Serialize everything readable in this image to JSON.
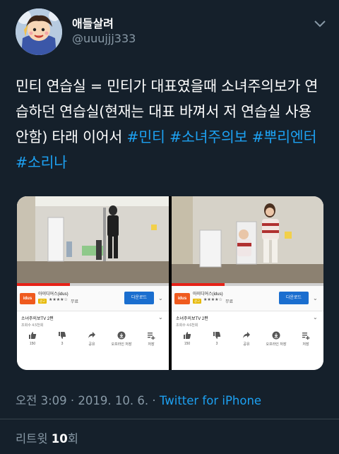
{
  "user": {
    "display_name": "애들살려",
    "handle": "@uuujjj333",
    "avatar": "cartoon-avatar"
  },
  "tweet": {
    "text_plain": "민티 연습실 = 민티가 대표였을때 소녀주의보가 연습하던 연습실(현재는 대표 바껴서 저 연습실 사용 안함) 타래 이어서 ",
    "hashtags": [
      "#민티",
      "#소녀주의보",
      "#뿌리엔터",
      "#소리나"
    ]
  },
  "media": [
    {
      "ad": {
        "logo": "idus",
        "name": "아이디어스(idus)",
        "tag": "광고",
        "stars": "★★★★☆",
        "price": "무료",
        "install": "다운로드"
      },
      "video_title": "소녀주의보TV 2편",
      "views": "조회수 4.5천회",
      "progress": 0.35,
      "actions": [
        {
          "icon": "thumbs-up-icon",
          "label": "150"
        },
        {
          "icon": "thumbs-down-icon",
          "label": "3"
        },
        {
          "icon": "share-icon",
          "label": "공유"
        },
        {
          "icon": "download-icon",
          "label": "오프라인 저장"
        },
        {
          "icon": "playlist-add-icon",
          "label": "저장"
        }
      ]
    },
    {
      "ad": {
        "logo": "idus",
        "name": "아이디어스(idus)",
        "tag": "광고",
        "stars": "★★★★☆",
        "price": "무료",
        "install": "다운로드"
      },
      "video_title": "소녀주의보TV 2편",
      "views": "조회수 4.6천회",
      "progress": 0.35,
      "actions": [
        {
          "icon": "thumbs-up-icon",
          "label": "150"
        },
        {
          "icon": "thumbs-down-icon",
          "label": "3"
        },
        {
          "icon": "share-icon",
          "label": "공유"
        },
        {
          "icon": "download-icon",
          "label": "오프라인 저장"
        },
        {
          "icon": "playlist-add-icon",
          "label": "저장"
        }
      ]
    }
  ],
  "meta": {
    "time": "오전 3:09",
    "separator": " · ",
    "date": "2019. 10. 6.",
    "source": "Twitter for iPhone"
  },
  "retweets": {
    "label_prefix": "리트윗 ",
    "count": "10",
    "label_suffix": "회"
  },
  "colors": {
    "background": "#15202b",
    "link": "#1da1f2",
    "secondary_text": "#8899a6",
    "divider": "#38444d"
  }
}
